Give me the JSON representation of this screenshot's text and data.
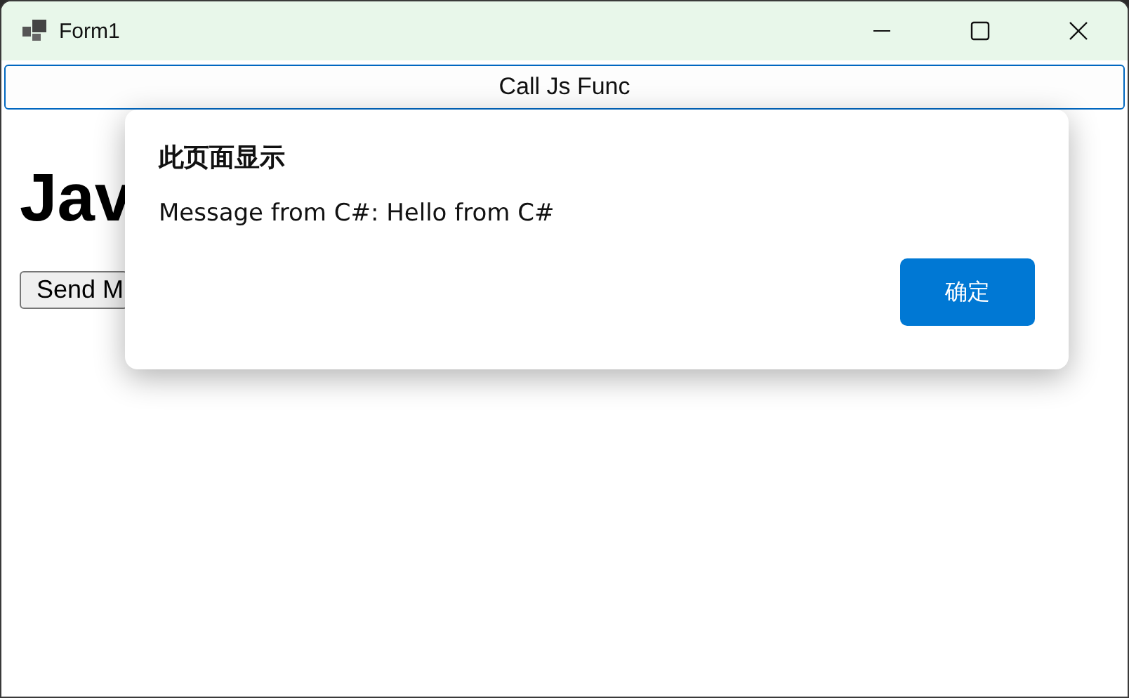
{
  "window": {
    "title": "Form1"
  },
  "toolbar_button": {
    "label": "Call Js Func"
  },
  "page": {
    "heading": "Jav",
    "button": "Send M"
  },
  "dialog": {
    "title": "此页面显示",
    "message": "Message from C#: Hello from C#",
    "ok_button": "确定"
  }
}
